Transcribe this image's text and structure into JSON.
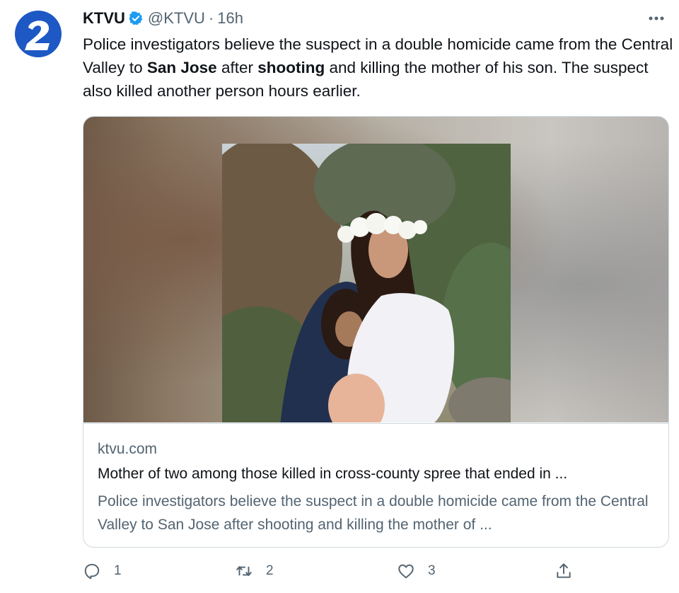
{
  "account": {
    "name": "KTVU",
    "handle": "@KTVU",
    "separator": "·",
    "time": "16h",
    "verified": true,
    "avatar_icon": "ktvu-2-logo",
    "brand_color": "#1d58c4"
  },
  "menu": {
    "icon": "more-horizontal-icon"
  },
  "tweet": {
    "text_parts": [
      "Police investigators believe the suspect in a double homicide came from the Central Valley to ",
      "San Jose",
      " after ",
      "shooting",
      " and killing the mother of his son. The suspect also killed another person hours earlier."
    ]
  },
  "card": {
    "domain": "ktvu.com",
    "title": "Mother of two among those killed in cross-county spree that ended in ...",
    "description": "Police investigators believe the suspect in a double homicide came from the Central Valley to San Jose after shooting and killing the mother of ..."
  },
  "actions": {
    "reply": {
      "icon": "reply-icon",
      "count": "1"
    },
    "retweet": {
      "icon": "retweet-icon",
      "count": "2"
    },
    "like": {
      "icon": "heart-icon",
      "count": "3"
    },
    "share": {
      "icon": "share-icon"
    }
  },
  "colors": {
    "text": "#0f1419",
    "secondary": "#536471",
    "border": "#cfd9de",
    "verified": "#1d9bf0"
  }
}
